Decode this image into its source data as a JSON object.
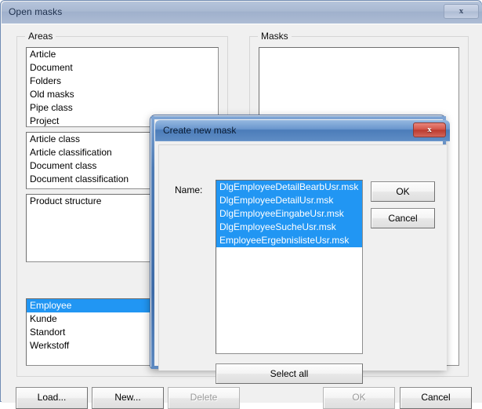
{
  "parent": {
    "title": "Open masks",
    "close_label": "x",
    "groups": {
      "areas": {
        "label": "Areas"
      },
      "masks": {
        "label": "Masks"
      }
    },
    "lists": {
      "areas_1": [
        "Article",
        "Document",
        "Folders",
        "Old masks",
        "Pipe class",
        "Project"
      ],
      "areas_2": [
        "Article class",
        "Article classification",
        "Document class",
        "Document classification"
      ],
      "areas_3": [
        "Product structure"
      ],
      "areas_4": [
        "Employee",
        "Kunde",
        "Standort",
        "Werkstoff"
      ],
      "areas_4_selected_index": 0,
      "masks": []
    },
    "buttons": {
      "load": "Load...",
      "new": "New...",
      "delete": "Delete",
      "ok": "OK",
      "cancel": "Cancel"
    },
    "disabled_buttons": [
      "delete",
      "ok"
    ]
  },
  "child": {
    "title": "Create new mask",
    "close_label": "x",
    "name_label": "Name:",
    "name_list": [
      "DlgEmployeeDetailBearbUsr.msk",
      "DlgEmployeeDetailUsr.msk",
      "DlgEmployeeEingabeUsr.msk",
      "DlgEmployeeSucheUsr.msk",
      "EmployeeErgebnislisteUsr.msk"
    ],
    "name_list_all_selected": true,
    "buttons": {
      "ok": "OK",
      "cancel": "Cancel",
      "select_all": "Select all"
    }
  },
  "colors": {
    "selection_blue": "#2196f3",
    "window_bg": "#f0f0f0",
    "active_title": "#4b7cb9",
    "inactive_title": "#a9b9d2",
    "close_red": "#bb3a2e"
  }
}
